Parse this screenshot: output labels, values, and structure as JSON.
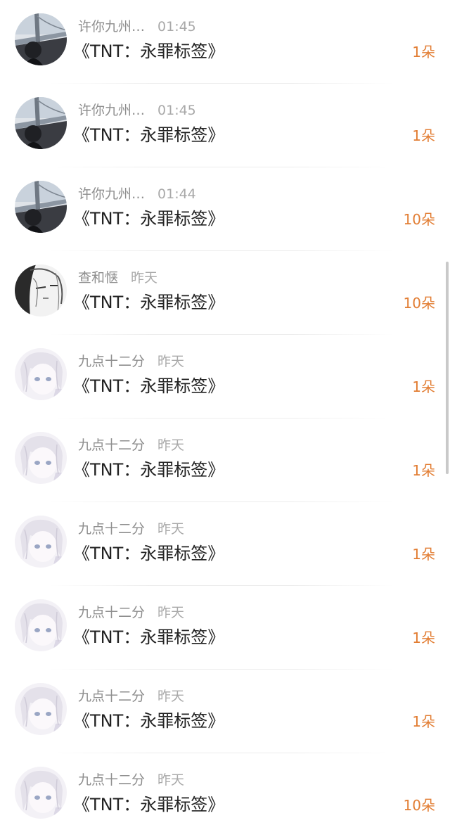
{
  "items": [
    {
      "name": "许你九州…",
      "time": "01:45",
      "title": "《TNT：永罪标签》",
      "count": "1朵",
      "avatar": "bridge-avatar-icon"
    },
    {
      "name": "许你九州…",
      "time": "01:45",
      "title": "《TNT：永罪标签》",
      "count": "1朵",
      "avatar": "bridge-avatar-icon"
    },
    {
      "name": "许你九州…",
      "time": "01:44",
      "title": "《TNT：永罪标签》",
      "count": "10朵",
      "avatar": "bridge-avatar-icon"
    },
    {
      "name": "查和惬",
      "time": "昨天",
      "title": "《TNT：永罪标签》",
      "count": "10朵",
      "avatar": "sketch-avatar-icon"
    },
    {
      "name": "九点十二分",
      "time": "昨天",
      "title": "《TNT：永罪标签》",
      "count": "1朵",
      "avatar": "anime-avatar-icon"
    },
    {
      "name": "九点十二分",
      "time": "昨天",
      "title": "《TNT：永罪标签》",
      "count": "1朵",
      "avatar": "anime-avatar-icon"
    },
    {
      "name": "九点十二分",
      "time": "昨天",
      "title": "《TNT：永罪标签》",
      "count": "1朵",
      "avatar": "anime-avatar-icon"
    },
    {
      "name": "九点十二分",
      "time": "昨天",
      "title": "《TNT：永罪标签》",
      "count": "1朵",
      "avatar": "anime-avatar-icon"
    },
    {
      "name": "九点十二分",
      "time": "昨天",
      "title": "《TNT：永罪标签》",
      "count": "1朵",
      "avatar": "anime-avatar-icon"
    },
    {
      "name": "九点十二分",
      "time": "昨天",
      "title": "《TNT：永罪标签》",
      "count": "10朵",
      "avatar": "anime-avatar-icon"
    }
  ],
  "colors": {
    "accent": "#e27d33",
    "title": "#222222",
    "meta": "#9a9a9a"
  }
}
